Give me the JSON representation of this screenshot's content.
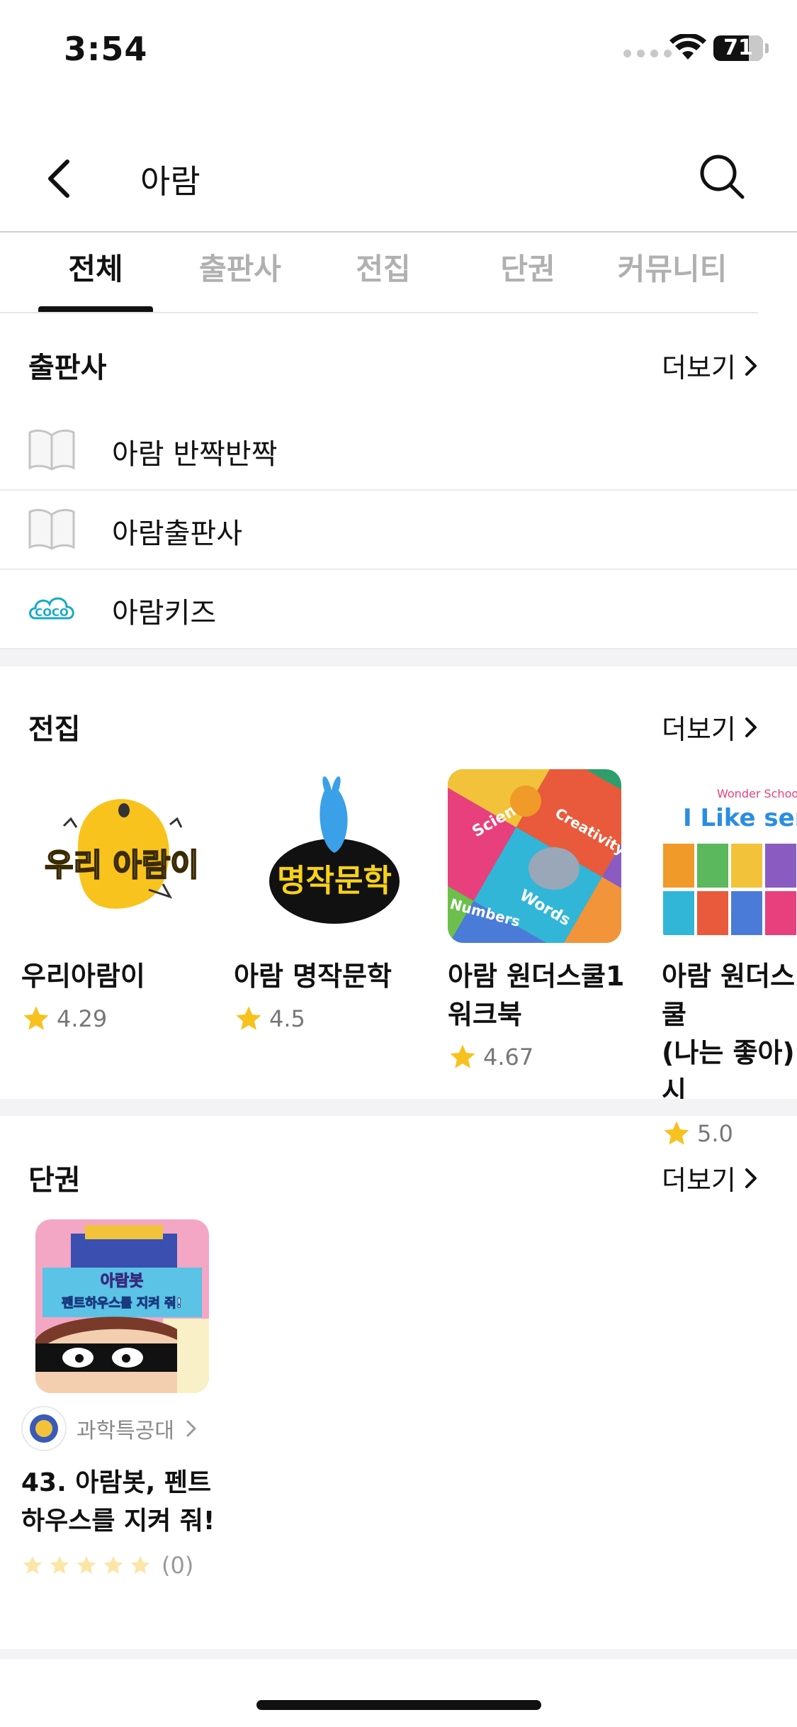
{
  "status": {
    "time": "3:54",
    "battery": "71",
    "battery_level": 0.71
  },
  "header": {
    "query": "아람"
  },
  "tabs": [
    "전체",
    "출판사",
    "전집",
    "단권",
    "커뮤니티"
  ],
  "publishers": {
    "title": "출판사",
    "more": "더보기",
    "items": [
      {
        "label": "아람 반짝반짝",
        "icon": "book-outline-icon"
      },
      {
        "label": "아람출판사",
        "icon": "book-outline-icon"
      },
      {
        "label": "아람키즈",
        "icon": "coco-cloud-logo"
      }
    ]
  },
  "sets": {
    "title": "전집",
    "more": "더보기",
    "items": [
      {
        "title": "우리아람이",
        "rating": "4.29",
        "cover_text": "우리 아람이"
      },
      {
        "title": "아람 명작문학",
        "rating": "4.5",
        "cover_text": "명작문학"
      },
      {
        "title": "아람 원더스쿨1\n워크북",
        "rating": "4.67",
        "cover_words": [
          "Science",
          "Creativity",
          "Words",
          "Numbers"
        ]
      },
      {
        "title": "아람 원더스쿨\n(나는 좋아) 시",
        "rating": "5.0",
        "cover_header": "Wonder School",
        "cover_title": "I Like series"
      }
    ]
  },
  "singles": {
    "title": "단권",
    "more": "더보기",
    "book": {
      "publisher": "과학특공대",
      "title": "43. 아람봇, 펜트하우스를 지켜 줘!",
      "review_count": "(0)",
      "cover_title": "아람봇",
      "cover_subtitle": "펜트하우스를 지켜 줘!"
    }
  },
  "colors": {
    "star": "#f7c21e",
    "star_empty": "#fbe6a8",
    "text_muted": "#b0b0b0"
  }
}
